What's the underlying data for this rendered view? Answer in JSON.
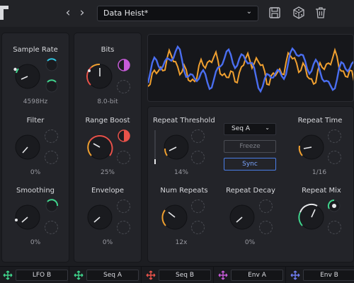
{
  "toolbar": {
    "preset_name": "Data Heist*",
    "back_icon": "chevron-left-icon",
    "forward_icon": "chevron-right-icon",
    "save_icon": "save-icon",
    "random_icon": "dice-icon",
    "delete_icon": "trash-icon"
  },
  "controls": {
    "sample_rate": {
      "label": "Sample Rate",
      "value": "4598Hz",
      "level": 0.3
    },
    "filter": {
      "label": "Filter",
      "value": "0%",
      "level": 0.0
    },
    "smoothing": {
      "label": "Smoothing",
      "value": "0%",
      "level": 0.0
    },
    "bits": {
      "label": "Bits",
      "value": "8.0-bit",
      "level": 0.55
    },
    "range_boost": {
      "label": "Range Boost",
      "value": "25%",
      "level": 0.75
    },
    "envelope": {
      "label": "Envelope",
      "value": "0%",
      "level": 0.0
    },
    "repeat_threshold": {
      "label": "Repeat Threshold",
      "value": "14%",
      "level": 0.14
    },
    "repeat_time": {
      "label": "Repeat Time",
      "value": "1/16",
      "level": 0.18
    },
    "num_repeats": {
      "label": "Num Repeats",
      "value": "12x",
      "level": 0.3
    },
    "repeat_decay": {
      "label": "Repeat Decay",
      "value": "0%",
      "level": 0.0
    },
    "repeat_mix": {
      "label": "Repeat Mix",
      "value": "",
      "level": 0.62
    }
  },
  "repeater": {
    "sequence": "Seq A",
    "freeze_label": "Freeze",
    "sync_label": "Sync",
    "threshold_slider": 0.14
  },
  "modulators": [
    {
      "label": "LFO B",
      "color": "#3fd48c"
    },
    {
      "label": "Seq A",
      "color": "#3fd48c"
    },
    {
      "label": "Seq B",
      "color": "#e8524a"
    },
    {
      "label": "Env A",
      "color": "#c65bd8"
    },
    {
      "label": "Env B",
      "color": "#6f7df0"
    }
  ],
  "colors": {
    "accent_blue": "#4a7ee8",
    "accent_orange": "#f0a030",
    "mod_green": "#3fd48c",
    "mod_red": "#e8524a",
    "mod_purple": "#c65bd8"
  }
}
